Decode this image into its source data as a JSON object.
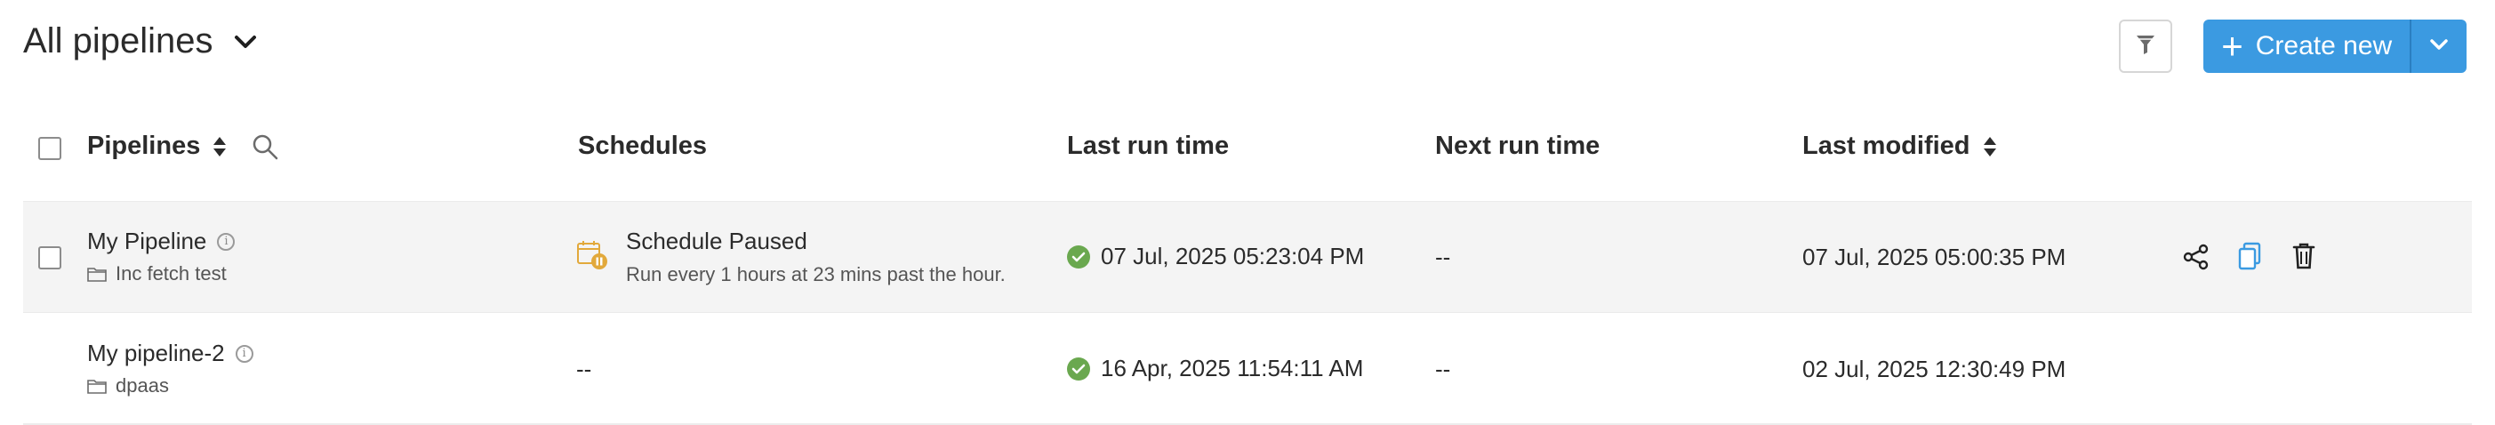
{
  "header": {
    "title": "All pipelines",
    "create_label": "Create new",
    "icons": [
      "chevron-down-icon",
      "filter-icon",
      "plus-icon",
      "dropdown-caret-icon"
    ],
    "accent": "#3b9ae1"
  },
  "columns": {
    "pipelines": "Pipelines",
    "schedules": "Schedules",
    "last_run": "Last run time",
    "next_run": "Next run time",
    "last_modified": "Last modified"
  },
  "rows": [
    {
      "name": "My Pipeline",
      "folder": "Inc fetch test",
      "schedule_title": "Schedule Paused",
      "schedule_desc": "Run every 1 hours at 23 mins past the hour.",
      "last_run": "07 Jul, 2025 05:23:04 PM",
      "next_run": "--",
      "last_modified": "07 Jul, 2025 05:00:35 PM",
      "status_color": "#6aa84f"
    },
    {
      "name": "My pipeline-2",
      "folder": "dpaas",
      "schedule": "--",
      "last_run": "16 Apr, 2025 11:54:11 AM",
      "next_run": "--",
      "last_modified": "02 Jul, 2025 12:30:49 PM",
      "status_color": "#6aa84f"
    }
  ]
}
